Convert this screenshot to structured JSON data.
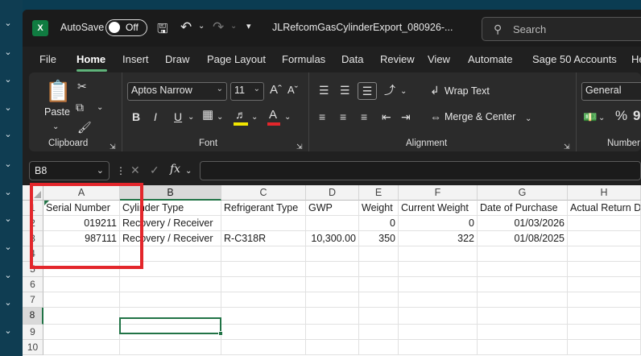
{
  "app": {
    "title": "JLRefcomGasCylinderExport_080926-...",
    "autosave_label": "AutoSave",
    "autosave_state": "Off",
    "search_placeholder": "Search"
  },
  "tabs": [
    "File",
    "Home",
    "Insert",
    "Draw",
    "Page Layout",
    "Formulas",
    "Data",
    "Review",
    "View",
    "Automate",
    "Sage 50 Accounts",
    "He"
  ],
  "active_tab": "Home",
  "ribbon": {
    "clipboard": {
      "paste": "Paste",
      "label": "Clipboard"
    },
    "font": {
      "name": "Aptos Narrow",
      "size": "11",
      "label": "Font",
      "bold": "B",
      "italic": "I",
      "underline": "U"
    },
    "alignment": {
      "wrap": "Wrap Text",
      "merge": "Merge & Center",
      "label": "Alignment"
    },
    "number": {
      "format": "General",
      "label": "Number",
      "percent": "%",
      "comma": "9"
    }
  },
  "formula_bar": {
    "name_box": "B8",
    "fx": "fx",
    "value": ""
  },
  "sheet": {
    "columns": [
      "A",
      "B",
      "C",
      "D",
      "E",
      "F",
      "G",
      "H"
    ],
    "rows": [
      "1",
      "2",
      "3",
      "4",
      "5",
      "6",
      "7",
      "8",
      "9",
      "10"
    ],
    "selected_cell": "B8",
    "headers": [
      "Serial Number",
      "Cylinder Type",
      "Refrigerant Type",
      "GWP",
      "Weight",
      "Current Weight",
      "Date of Purchase",
      "Actual Return D"
    ],
    "data": [
      [
        "019211",
        "Recovery / Receiver",
        "",
        "",
        "0",
        "0",
        "01/03/2026",
        ""
      ],
      [
        "987111",
        "Recovery / Receiver",
        "R-C318R",
        "10,300.00",
        "350",
        "322",
        "01/08/2025",
        ""
      ]
    ]
  },
  "annotation": {
    "color": "#e3262b"
  },
  "colors": {
    "accent": "#217346",
    "dark_bg": "#202020"
  }
}
